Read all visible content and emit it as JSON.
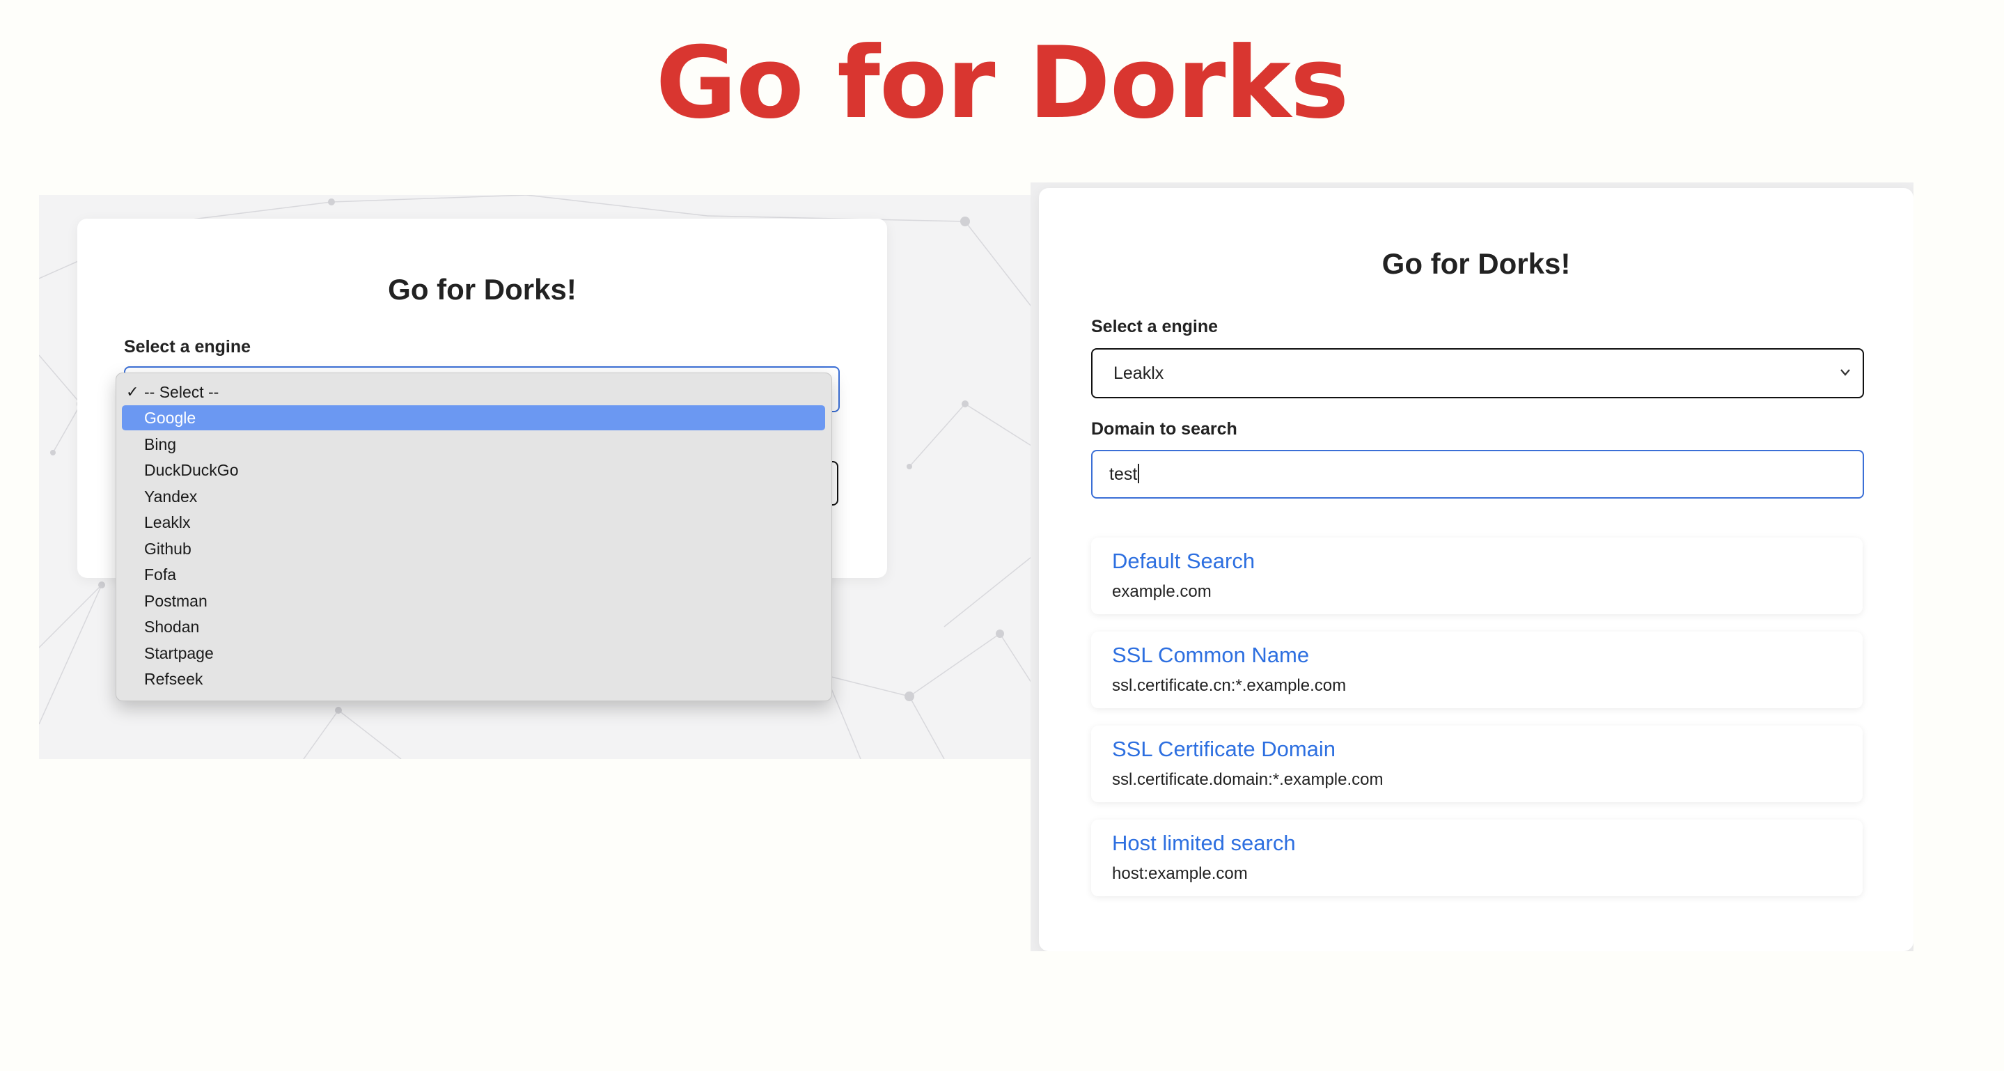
{
  "hero_title": "Go for Dorks",
  "left_form": {
    "title": "Go for Dorks!",
    "engine_label": "Select a engine",
    "dropdown": {
      "check_mark": "✓",
      "options": [
        "-- Select --",
        "Google",
        "Bing",
        "DuckDuckGo",
        "Yandex",
        "Leaklx",
        "Github",
        "Fofa",
        "Postman",
        "Shodan",
        "Startpage",
        "Refseek"
      ],
      "checked_option": "-- Select --",
      "highlighted_option": "Google"
    }
  },
  "right_form": {
    "title": "Go for Dorks!",
    "engine_label": "Select a engine",
    "engine_value": "Leaklx",
    "domain_label": "Domain to search",
    "domain_value": "test",
    "results": [
      {
        "title": "Default Search",
        "query": "example.com"
      },
      {
        "title": "SSL Common Name",
        "query": "ssl.certificate.cn:*.example.com"
      },
      {
        "title": "SSL Certificate Domain",
        "query": "ssl.certificate.domain:*.example.com"
      },
      {
        "title": "Host limited search",
        "query": "host:example.com"
      }
    ]
  },
  "colors": {
    "hero_title": "#d93630",
    "link": "#2d6fe0",
    "highlight": "#6b98f2",
    "focus_border": "#3b6fd6"
  },
  "icons": {
    "select_chevron": "chevron-down-icon",
    "checkmark": "checkmark-icon"
  }
}
